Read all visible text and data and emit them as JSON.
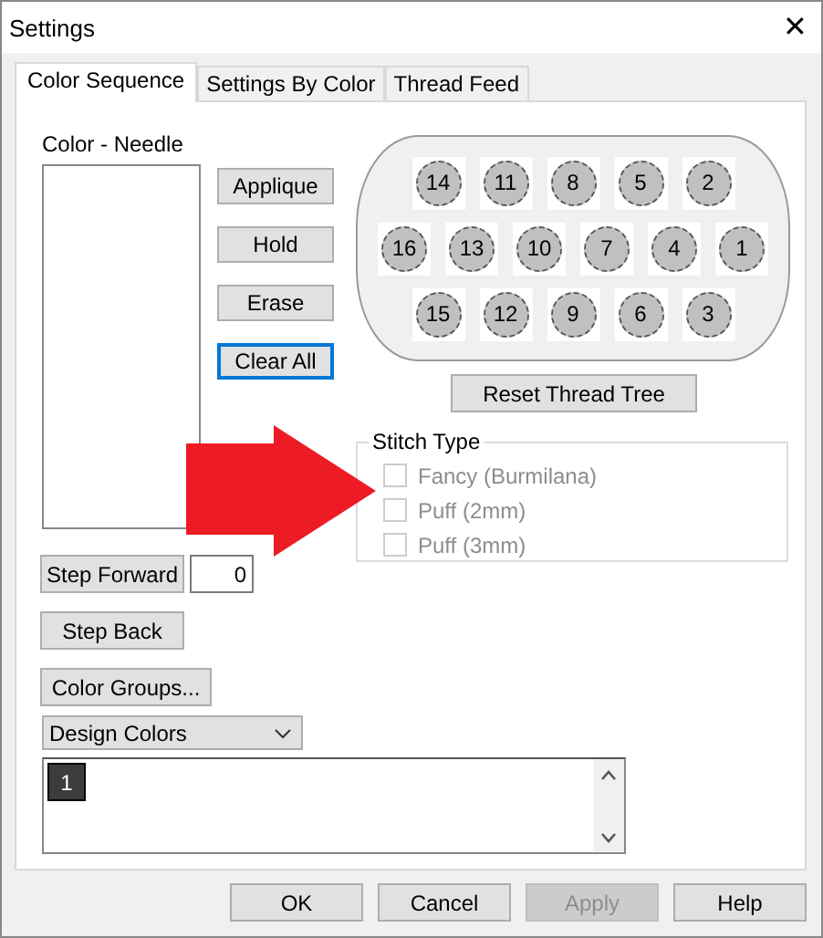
{
  "window": {
    "title": "Settings",
    "close": "✕"
  },
  "tabs": [
    {
      "label": "Color Sequence",
      "selected": true
    },
    {
      "label": "Settings By Color",
      "selected": false
    },
    {
      "label": "Thread Feed",
      "selected": false
    }
  ],
  "color_needle": {
    "label": "Color - Needle"
  },
  "action_buttons": [
    {
      "label": "Applique",
      "focused": false
    },
    {
      "label": "Hold",
      "focused": false
    },
    {
      "label": "Erase",
      "focused": false
    },
    {
      "label": "Clear All",
      "focused": true
    }
  ],
  "thread_tree": {
    "rows": [
      [
        "14",
        "11",
        "8",
        "5",
        "2"
      ],
      [
        "16",
        "13",
        "10",
        "7",
        "4",
        "1"
      ],
      [
        "15",
        "12",
        "9",
        "6",
        "3"
      ]
    ],
    "reset_button": "Reset Thread Tree"
  },
  "stitch_type": {
    "title": "Stitch Type",
    "options": [
      {
        "label": "Fancy (Burmilana)",
        "checked": false,
        "disabled": true
      },
      {
        "label": "Puff (2mm)",
        "checked": false,
        "disabled": true
      },
      {
        "label": "Puff (3mm)",
        "checked": false,
        "disabled": true
      }
    ]
  },
  "step_forward": {
    "label": "Step Forward",
    "value": "0"
  },
  "step_back": "Step Back",
  "color_groups": "Color Groups...",
  "dropdown": {
    "value": "Design Colors"
  },
  "color_list": [
    {
      "label": "1",
      "color": "#3c3c3c"
    }
  ],
  "footer_buttons": [
    {
      "label": "OK",
      "disabled": false
    },
    {
      "label": "Cancel",
      "disabled": false
    },
    {
      "label": "Apply",
      "disabled": true
    },
    {
      "label": "Help",
      "disabled": false
    }
  ]
}
